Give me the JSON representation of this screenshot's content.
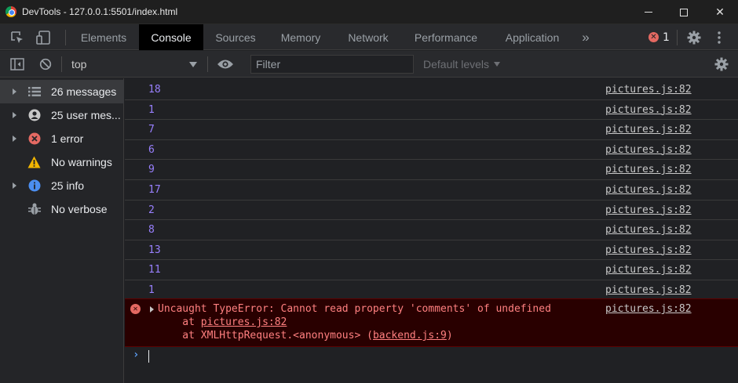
{
  "window": {
    "title": "DevTools - 127.0.0.1:5501/index.html",
    "min_glyph": "",
    "close_glyph": "✕"
  },
  "tabs": [
    {
      "label": "Elements",
      "active": false
    },
    {
      "label": "Console",
      "active": true
    },
    {
      "label": "Sources",
      "active": false
    },
    {
      "label": "Memory",
      "active": false
    },
    {
      "label": "Network",
      "active": false
    },
    {
      "label": "Performance",
      "active": false
    },
    {
      "label": "Application",
      "active": false
    }
  ],
  "tabbar": {
    "more_glyph": "»",
    "error_count": "1",
    "error_glyph": "✕"
  },
  "console_toolbar": {
    "context": "top",
    "filter_placeholder": "Filter",
    "levels": "Default levels"
  },
  "sidebar": {
    "items": [
      {
        "label": "26 messages",
        "icon": "list-icon",
        "expandable": true,
        "selected": true
      },
      {
        "label": "25 user mes...",
        "icon": "user-icon",
        "expandable": true,
        "selected": false
      },
      {
        "label": "1 error",
        "icon": "error-icon",
        "expandable": true,
        "selected": false
      },
      {
        "label": "No warnings",
        "icon": "warning-icon",
        "expandable": false,
        "selected": false
      },
      {
        "label": "25 info",
        "icon": "info-icon",
        "expandable": true,
        "selected": false
      },
      {
        "label": "No verbose",
        "icon": "bug-icon",
        "expandable": false,
        "selected": false
      }
    ]
  },
  "messages": [
    {
      "value": "18",
      "source": "pictures.js:82"
    },
    {
      "value": "1",
      "source": "pictures.js:82"
    },
    {
      "value": "7",
      "source": "pictures.js:82"
    },
    {
      "value": "6",
      "source": "pictures.js:82"
    },
    {
      "value": "9",
      "source": "pictures.js:82"
    },
    {
      "value": "17",
      "source": "pictures.js:82"
    },
    {
      "value": "2",
      "source": "pictures.js:82"
    },
    {
      "value": "8",
      "source": "pictures.js:82"
    },
    {
      "value": "13",
      "source": "pictures.js:82"
    },
    {
      "value": "11",
      "source": "pictures.js:82"
    },
    {
      "value": "1",
      "source": "pictures.js:82"
    }
  ],
  "error": {
    "message": "Uncaught TypeError: Cannot read property 'comments' of undefined",
    "source": "pictures.js:82",
    "stack1_prefix": "    at ",
    "stack1_link": "pictures.js:82",
    "stack2_prefix": "    at XMLHttpRequest.<anonymous> (",
    "stack2_link": "backend.js:9",
    "stack2_suffix": ")",
    "glyph": "✕"
  },
  "prompt": {
    "glyph": "›"
  },
  "colors": {
    "log_number": "#9980ff",
    "error_text": "#ff8080",
    "error_bg": "#290000",
    "accent_prompt": "#5b9cf0"
  }
}
